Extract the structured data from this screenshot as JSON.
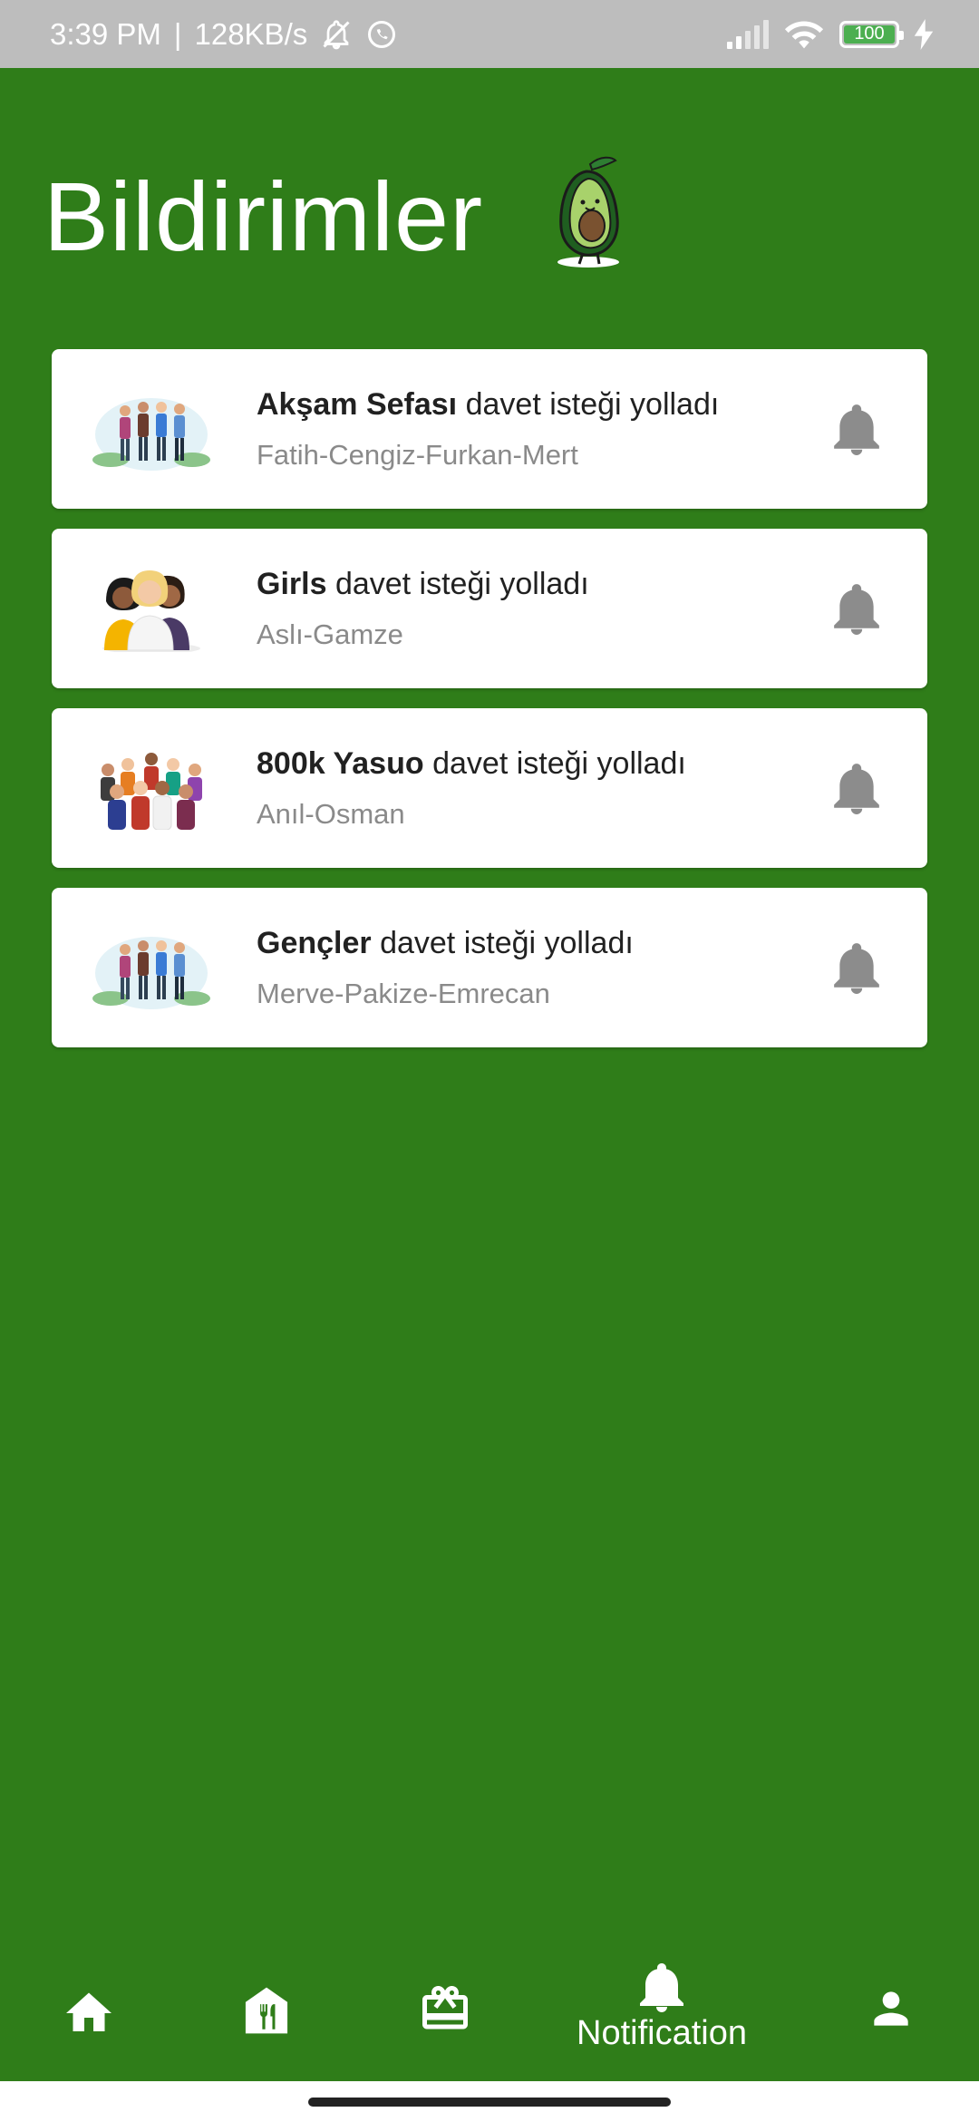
{
  "status_bar": {
    "time": "3:39 PM",
    "separator": "|",
    "net_speed": "128KB/s",
    "battery": "100",
    "icons": [
      "mute-icon",
      "whatsapp-icon",
      "signal-icon",
      "wifi-icon",
      "battery-icon",
      "charging-icon"
    ]
  },
  "header": {
    "title": "Bildirimler",
    "mascot_icon": "avocado-mascot"
  },
  "notifications": [
    {
      "group": "Akşam Sefası",
      "message": "davet isteği yolladı",
      "members": "Fatih-Cengiz-Furkan-Mert",
      "avatar": "group-of-four-people",
      "action_icon": "bell-icon"
    },
    {
      "group": "Girls",
      "message": "davet isteği yolladı",
      "members": "Aslı-Gamze",
      "avatar": "three-women",
      "action_icon": "bell-icon"
    },
    {
      "group": "800k Yasuo",
      "message": "davet isteği yolladı",
      "members": "Anıl-Osman",
      "avatar": "crowd-of-people",
      "action_icon": "bell-icon"
    },
    {
      "group": "Gençler",
      "message": "davet isteği yolladı",
      "members": "Merve-Pakize-Emrecan",
      "avatar": "group-of-four-people",
      "action_icon": "bell-icon"
    }
  ],
  "bottom_nav": {
    "items": [
      {
        "icon": "home-icon",
        "label": ""
      },
      {
        "icon": "restaurant-icon",
        "label": ""
      },
      {
        "icon": "gift-card-icon",
        "label": ""
      },
      {
        "icon": "bell-icon",
        "label": "Notification",
        "active": true
      },
      {
        "icon": "person-icon",
        "label": ""
      }
    ]
  },
  "colors": {
    "primary_green": "#2f7d19",
    "status_bar_gray": "#bdbdbd",
    "card_white": "#ffffff",
    "subtitle_gray": "#8a8a8a",
    "bell_gray": "#8c8c8c"
  }
}
